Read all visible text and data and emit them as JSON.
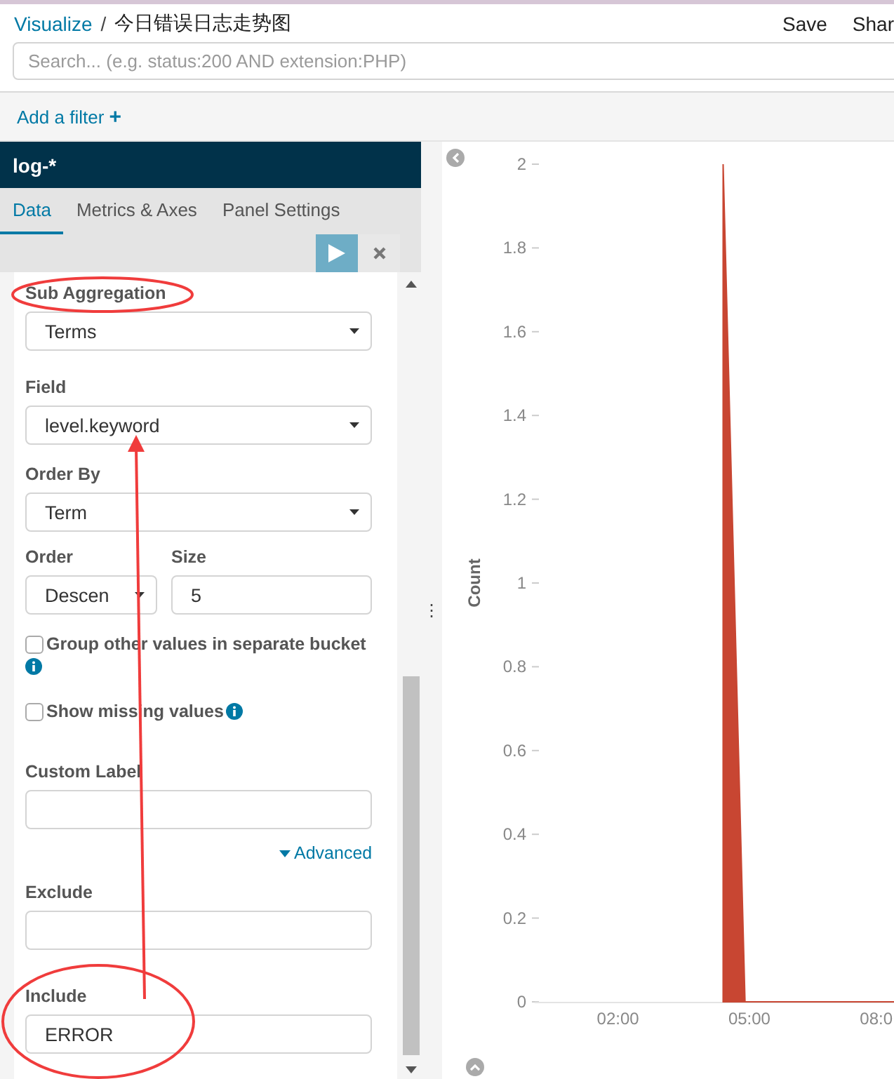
{
  "breadcrumb": {
    "link": "Visualize",
    "separator": "/",
    "title": "今日错误日志走势图"
  },
  "top_actions": [
    "Save",
    "Shar"
  ],
  "search": {
    "placeholder": "Search... (e.g. status:200 AND extension:PHP)"
  },
  "filter_bar": {
    "label": "Add a filter",
    "icon": "+"
  },
  "splitter_handle": "⋮",
  "sidebar": {
    "index_pattern": "log-*",
    "tabs": [
      {
        "label": "Data",
        "selected": true
      },
      {
        "label": "Metrics & Axes",
        "selected": false
      },
      {
        "label": "Panel Settings",
        "selected": false
      }
    ],
    "form": {
      "sub_aggregation": {
        "label": "Sub Aggregation",
        "value": "Terms"
      },
      "field": {
        "label": "Field",
        "value": "level.keyword"
      },
      "order_by": {
        "label": "Order By",
        "value": "Term"
      },
      "order": {
        "label": "Order",
        "value": "Descen"
      },
      "size": {
        "label": "Size",
        "value": "5"
      },
      "checkboxes": [
        {
          "label": "Group other values in separate bucket",
          "checked": false
        },
        {
          "label": "Show missing values",
          "checked": false
        }
      ],
      "custom_label": {
        "label": "Custom Label"
      },
      "advanced_toggle": {
        "label": "Advanced",
        "expanded": true
      },
      "exclude": {
        "label": "Exclude"
      },
      "include": {
        "label": "Include",
        "value": "ERROR"
      }
    }
  },
  "chart": {
    "chart_data": {
      "type": "area",
      "ylabel": "Count",
      "x": [
        4.4,
        4.4,
        4.9,
        8.3
      ],
      "values": [
        0,
        2,
        0,
        0
      ],
      "xlim": [
        0.1,
        8.3
      ],
      "ylim": [
        0,
        2
      ],
      "xticks": [
        {
          "value": 2,
          "label": "02:00"
        },
        {
          "value": 5,
          "label": "05:00"
        },
        {
          "value": 8,
          "label": "08:0"
        }
      ],
      "yticks": [
        0,
        0.2,
        0.4,
        0.6,
        0.8,
        1,
        1.2,
        1.4,
        1.6,
        1.8,
        2
      ]
    }
  }
}
